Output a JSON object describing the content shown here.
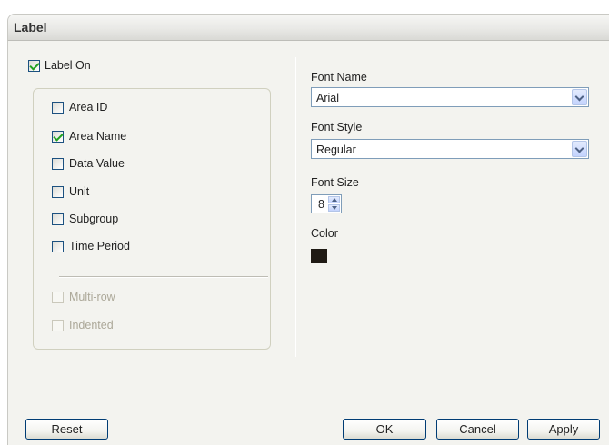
{
  "window": {
    "title": "Label"
  },
  "label_on": {
    "label": "Label On",
    "checked": true
  },
  "fields": [
    {
      "label": "Area ID",
      "checked": false
    },
    {
      "label": "Area Name",
      "checked": true
    },
    {
      "label": "Data Value",
      "checked": false
    },
    {
      "label": "Unit",
      "checked": false
    },
    {
      "label": "Subgroup",
      "checked": false
    },
    {
      "label": "Time Period",
      "checked": false
    }
  ],
  "options": [
    {
      "label": "Multi-row",
      "checked": false,
      "enabled": false
    },
    {
      "label": "Indented",
      "checked": false,
      "enabled": false
    }
  ],
  "font_name": {
    "label": "Font Name",
    "value": "Arial"
  },
  "font_style": {
    "label": "Font Style",
    "value": "Regular"
  },
  "font_size": {
    "label": "Font Size",
    "value": "8"
  },
  "color": {
    "label": "Color",
    "value": "#1f1a14"
  },
  "buttons": {
    "reset": "Reset",
    "ok": "OK",
    "cancel": "Cancel",
    "apply": "Apply"
  }
}
